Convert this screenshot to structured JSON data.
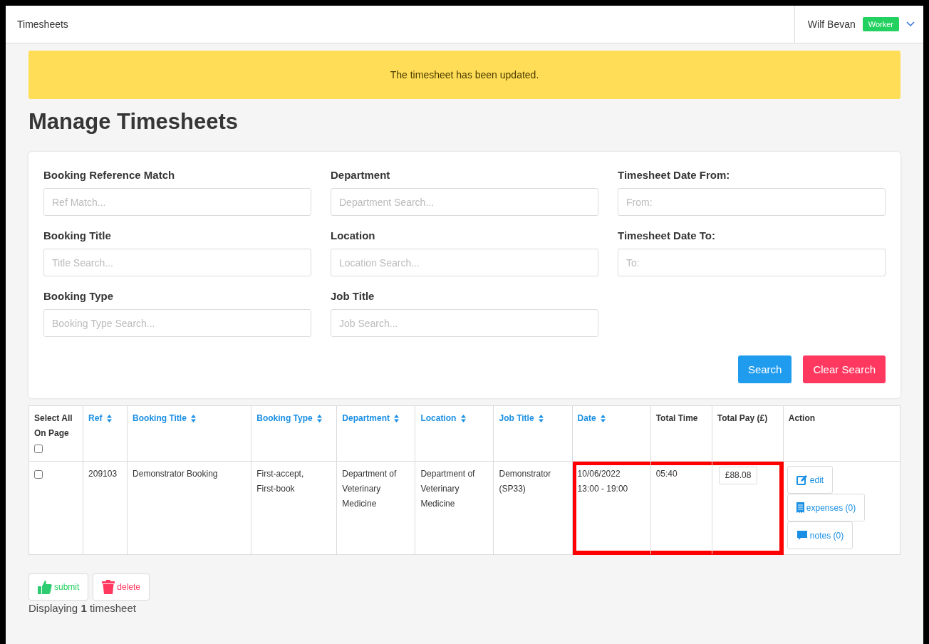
{
  "header": {
    "title": "Timesheets",
    "user": "Wilf Bevan",
    "role_badge": "Worker"
  },
  "alert": "The timesheet has been updated.",
  "page_title": "Manage Timesheets",
  "filters": [
    {
      "label": "Booking Reference Match",
      "placeholder": "Ref Match..."
    },
    {
      "label": "Department",
      "placeholder": "Department Search..."
    },
    {
      "label": "Timesheet Date From:",
      "placeholder": "From:"
    },
    {
      "label": "Booking Title",
      "placeholder": "Title Search..."
    },
    {
      "label": "Location",
      "placeholder": "Location Search..."
    },
    {
      "label": "Timesheet Date To:",
      "placeholder": "To:"
    },
    {
      "label": "Booking Type",
      "placeholder": "Booking Type Search..."
    },
    {
      "label": "Job Title",
      "placeholder": "Job Search..."
    }
  ],
  "search_buttons": [
    {
      "label": "Search",
      "kind": "primary"
    },
    {
      "label": "Clear Search",
      "kind": "danger"
    }
  ],
  "table": {
    "columns": [
      {
        "label": "Select All On Page",
        "kind": "select_all",
        "checked": false
      },
      {
        "label": "Ref",
        "kind": "sortable"
      },
      {
        "label": "Booking Title",
        "kind": "sortable"
      },
      {
        "label": "Booking Type",
        "kind": "sortable"
      },
      {
        "label": "Department",
        "kind": "sortable"
      },
      {
        "label": "Location",
        "kind": "sortable"
      },
      {
        "label": "Job Title",
        "kind": "sortable"
      },
      {
        "label": "Date",
        "kind": "sortable"
      },
      {
        "label": "Total Time",
        "kind": "plain"
      },
      {
        "label": "Total Pay (£)",
        "kind": "plain"
      },
      {
        "label": "Action",
        "kind": "plain"
      }
    ],
    "rows": [
      {
        "cells": [
          {
            "kind": "checkbox",
            "checked": false,
            "highlighted": false
          },
          {
            "kind": "text",
            "lines": [
              "209103"
            ],
            "highlighted": false
          },
          {
            "kind": "text",
            "lines": [
              "Demonstrator Booking"
            ],
            "highlighted": false
          },
          {
            "kind": "text",
            "lines": [
              "First-accept,",
              "First-book"
            ],
            "highlighted": false
          },
          {
            "kind": "text",
            "lines": [
              "Department of Veterinary Medicine"
            ],
            "highlighted": false
          },
          {
            "kind": "text",
            "lines": [
              "Department of Veterinary Medicine"
            ],
            "highlighted": false
          },
          {
            "kind": "text",
            "lines": [
              "Demonstrator (SP33)"
            ],
            "highlighted": false
          },
          {
            "kind": "text",
            "lines": [
              "10/06/2022",
              "13:00 - 19:00"
            ],
            "highlighted": true
          },
          {
            "kind": "text",
            "lines": [
              "05:40"
            ],
            "highlighted": true
          },
          {
            "kind": "pay",
            "lines": [
              "£88.08"
            ],
            "highlighted": true
          },
          {
            "kind": "actions",
            "highlighted": false,
            "actions": [
              {
                "label": "edit",
                "kind": "edit"
              },
              {
                "label": "expenses (0)",
                "kind": "expenses"
              },
              {
                "label": "notes (0)",
                "kind": "notes"
              }
            ]
          }
        ]
      }
    ]
  },
  "bulk_actions": [
    {
      "label": "submit",
      "kind": "submit"
    },
    {
      "label": "delete",
      "kind": "delete"
    }
  ],
  "summary": "Displaying **1** timesheet"
}
